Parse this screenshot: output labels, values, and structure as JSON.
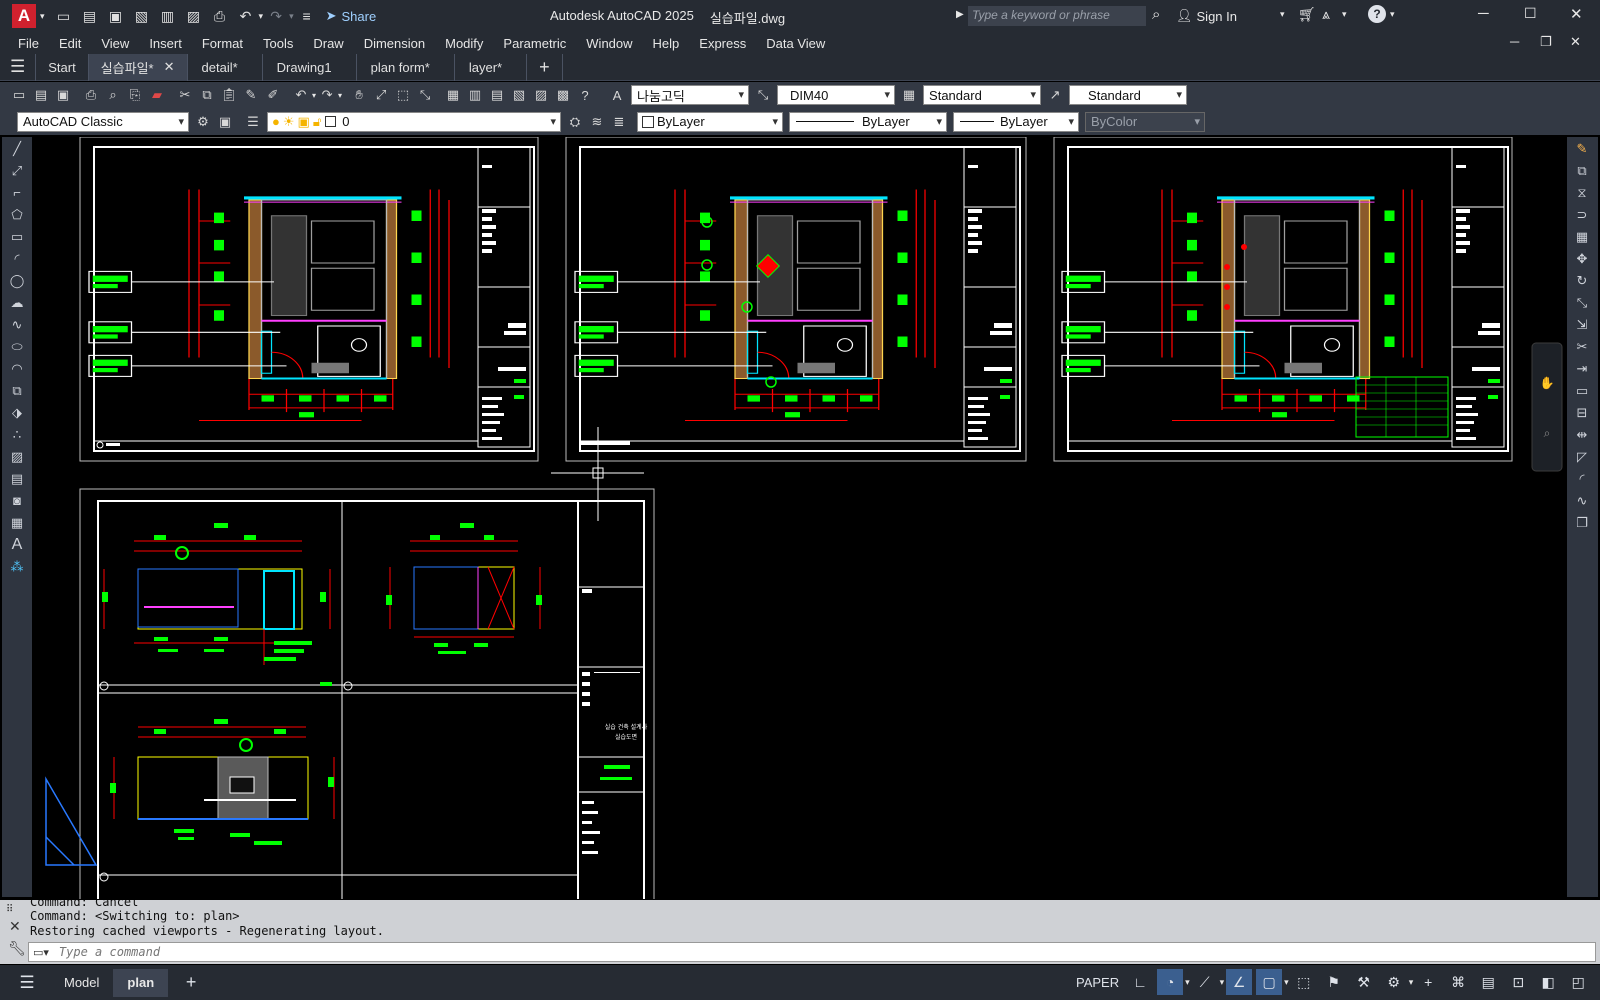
{
  "app": {
    "title": "Autodesk AutoCAD 2025",
    "file": "실습파일.dwg",
    "logo": "A"
  },
  "quick_access": {
    "share_label": "Share",
    "icons": [
      "new-icon",
      "open-icon",
      "save-icon",
      "saveas-icon",
      "openweb-icon",
      "saveweb-icon",
      "plot-icon",
      "undo-icon",
      "redo-icon",
      "customize-icon"
    ]
  },
  "search": {
    "placeholder": "Type a keyword or phrase"
  },
  "account": {
    "signin_label": "Sign In"
  },
  "menu": [
    "File",
    "Edit",
    "View",
    "Insert",
    "Format",
    "Tools",
    "Draw",
    "Dimension",
    "Modify",
    "Parametric",
    "Window",
    "Help",
    "Express",
    "Data View"
  ],
  "tabs": [
    {
      "label": "Start"
    },
    {
      "label": "실습파일*"
    },
    {
      "label": "detail*"
    },
    {
      "label": "Drawing1"
    },
    {
      "label": "plan form*"
    },
    {
      "label": "layer*"
    }
  ],
  "toolbar1": {
    "textstyle": "나눔고딕",
    "dimstyle": "DIM40",
    "tablestyle": "Standard",
    "mleaderstyle": "Standard"
  },
  "toolbar2": {
    "workspace": "AutoCAD Classic",
    "layer": "0",
    "color": "ByLayer",
    "linetype": "ByLayer",
    "lineweight": "ByLayer",
    "plotstyle": "ByColor"
  },
  "command": {
    "history": [
      "Command:  Cancel",
      "Command:   <Switching to: plan>",
      "Restoring cached viewports - Regenerating layout."
    ],
    "placeholder": "Type a command"
  },
  "status": {
    "model_tab": "Model",
    "layout_tab": "plan",
    "space": "PAPER"
  },
  "drawing_text": {
    "sheet_note_line1": "실습 건축 설계사",
    "sheet_note_line2": "실습도면"
  },
  "colors": {
    "accent": "#3b5f8f",
    "bg": "#000000",
    "chrome": "#262b33",
    "green": "#00ff00",
    "red": "#ff0000"
  }
}
